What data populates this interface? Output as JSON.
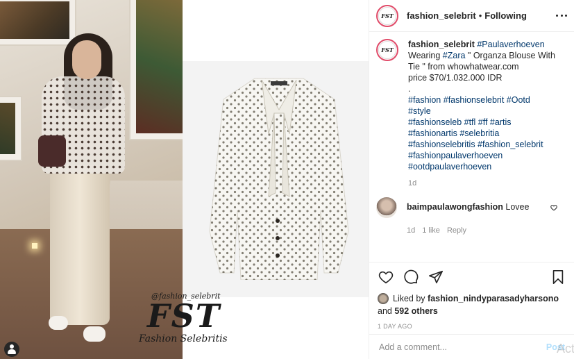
{
  "media": {
    "watermark_handle": "@fashion_selebrit",
    "watermark_logo": "FST",
    "watermark_name": "Fashion Selebritis",
    "avatar_logo": "FST"
  },
  "header": {
    "username": "fashion_selebrit",
    "separator": "•",
    "follow_status": "Following"
  },
  "caption": {
    "username": "fashion_selebrit",
    "first_tag": "#Paulaverhoeven",
    "line1_prefix": "Wearing ",
    "brand_tag": "#Zara",
    "line1_suffix": " \" Organza Blouse With Tie \" from whowhatwear.com",
    "price": "price $70/1.032.000 IDR",
    "dot": ".",
    "tags_line1": [
      "#fashion",
      "#fashionselebrit",
      "#Ootd"
    ],
    "tags": [
      "#style",
      "#fashionseleb #tfl #ff #artis",
      "#fashionartis #selebritia",
      "#fashionselebritis #fashion_selebrit",
      "#fashionpaulaverhoeven",
      "#ootdpaulaverhoeven"
    ],
    "time": "1d"
  },
  "comment": {
    "username": "baimpaulawongfashion",
    "text": "Lovee",
    "time": "1d",
    "likes": "1 like",
    "reply": "Reply"
  },
  "likes": {
    "prefix": "Liked by ",
    "user": "fashion_nindyparasadyharsono",
    "line2_prefix": "and ",
    "others": "592 others"
  },
  "date": "1 DAY AGO",
  "add_comment": {
    "placeholder": "Add a comment...",
    "post_label": "Post",
    "overlay_text": "Acti"
  }
}
